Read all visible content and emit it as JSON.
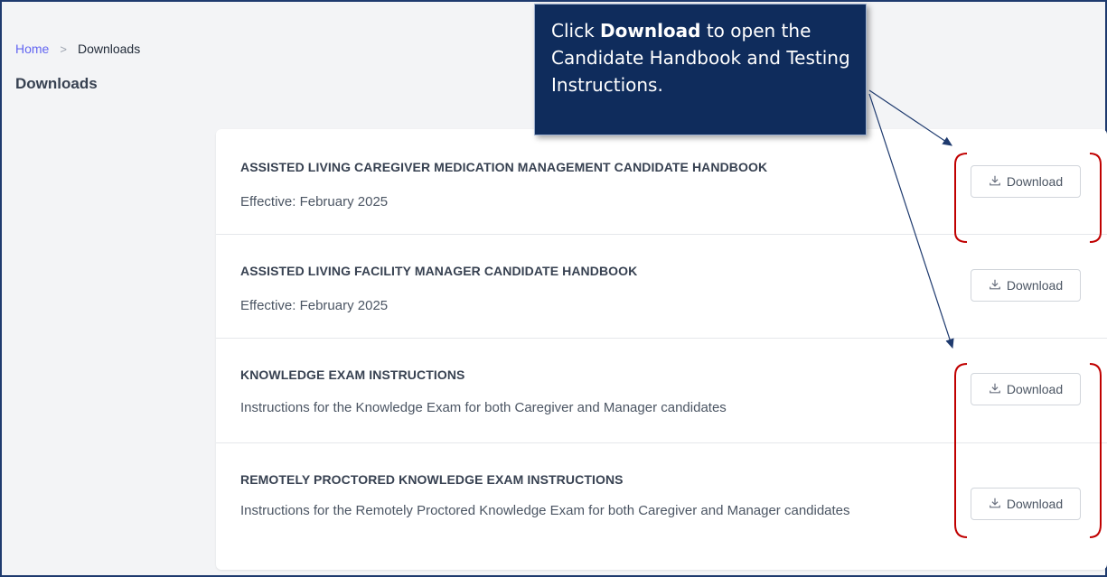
{
  "breadcrumb": {
    "home": "Home",
    "separator": ">",
    "current": "Downloads"
  },
  "page": {
    "title": "Downloads"
  },
  "downloads": [
    {
      "title": "ASSISTED LIVING CAREGIVER MEDICATION MANAGEMENT CANDIDATE HANDBOOK",
      "description": "Effective: February 2025",
      "button_label": "Download"
    },
    {
      "title": "ASSISTED LIVING FACILITY MANAGER CANDIDATE HANDBOOK",
      "description": "Effective: February 2025",
      "button_label": "Download"
    },
    {
      "title": "KNOWLEDGE EXAM INSTRUCTIONS",
      "description": "Instructions for the Knowledge Exam for both Caregiver and Manager candidates",
      "button_label": "Download"
    },
    {
      "title": "REMOTELY PROCTORED KNOWLEDGE EXAM INSTRUCTIONS",
      "description": "Instructions for the Remotely Proctored Knowledge Exam for both Caregiver and Manager candidates",
      "button_label": "Download"
    }
  ],
  "callout": {
    "prefix": "Click ",
    "bold": "Download",
    "suffix": " to open the Candidate Handbook and Testing Instructions."
  },
  "colors": {
    "frame_border": "#1e3a6e",
    "callout_bg": "#0f2c5c",
    "arrow": "#1e3a6e",
    "bracket": "#c00000",
    "link": "#6366f1"
  },
  "icons": {
    "download_button": "download-icon"
  }
}
